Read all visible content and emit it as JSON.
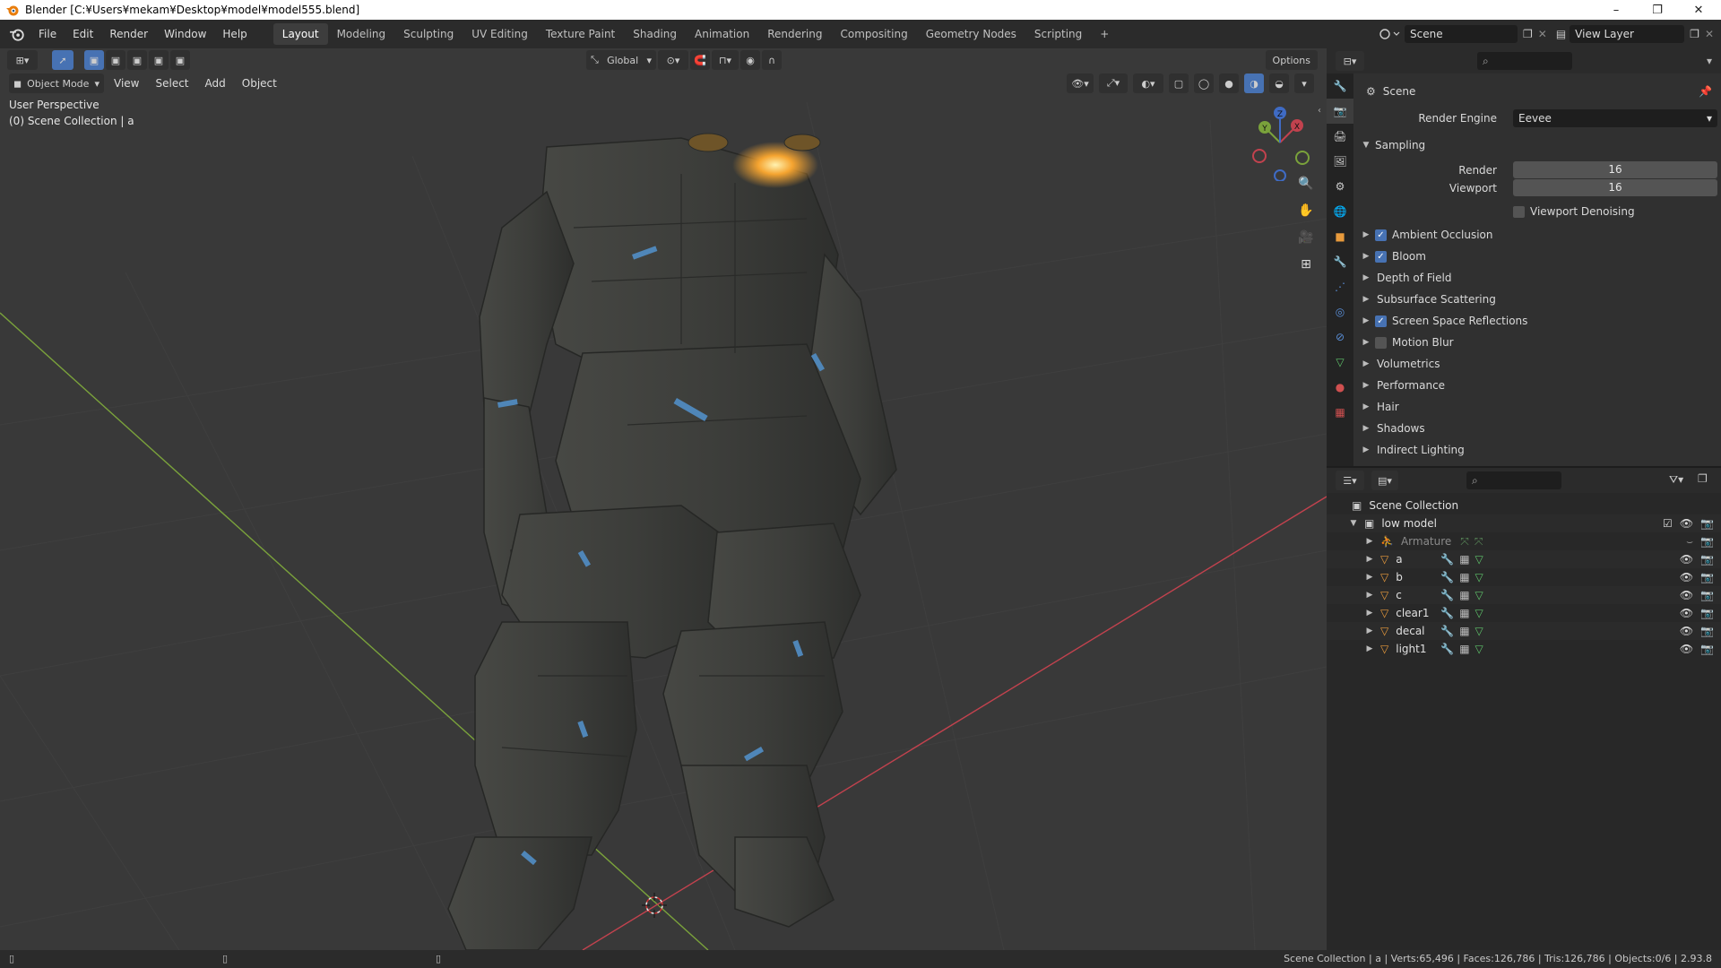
{
  "window": {
    "title": "Blender [C:¥Users¥mekam¥Desktop¥model¥model555.blend]",
    "controls": [
      "–",
      "❐",
      "✕"
    ]
  },
  "menu": [
    "File",
    "Edit",
    "Render",
    "Window",
    "Help"
  ],
  "workspaces": [
    "Layout",
    "Modeling",
    "Sculpting",
    "UV Editing",
    "Texture Paint",
    "Shading",
    "Animation",
    "Rendering",
    "Compositing",
    "Geometry Nodes",
    "Scripting"
  ],
  "active_workspace": "Layout",
  "add_workspace": "+",
  "scene_selector": {
    "value": "Scene"
  },
  "view_layer_selector": {
    "value": "View Layer"
  },
  "viewport": {
    "transform_orientation": "Global",
    "options_label": "Options",
    "mode": "Object Mode",
    "menus": [
      "View",
      "Select",
      "Add",
      "Object"
    ],
    "overlay_line1": "User Perspective",
    "overlay_line2": "(0) Scene Collection | a",
    "gizmo_axes": {
      "x": "X",
      "y": "Y",
      "z": "Z"
    }
  },
  "properties": {
    "context": "Scene",
    "render_engine_label": "Render Engine",
    "render_engine_value": "Eevee",
    "sampling": {
      "label": "Sampling",
      "render_label": "Render",
      "render_value": "16",
      "viewport_label": "Viewport",
      "viewport_value": "16",
      "denoise_label": "Viewport Denoising"
    },
    "panels": [
      {
        "label": "Ambient Occlusion",
        "checkbox": true,
        "checked": true
      },
      {
        "label": "Bloom",
        "checkbox": true,
        "checked": true
      },
      {
        "label": "Depth of Field",
        "checkbox": false
      },
      {
        "label": "Subsurface Scattering",
        "checkbox": false
      },
      {
        "label": "Screen Space Reflections",
        "checkbox": true,
        "checked": true
      },
      {
        "label": "Motion Blur",
        "checkbox": true,
        "checked": false
      },
      {
        "label": "Volumetrics",
        "checkbox": false
      },
      {
        "label": "Performance",
        "checkbox": false
      },
      {
        "label": "Hair",
        "checkbox": false
      },
      {
        "label": "Shadows",
        "checkbox": false
      },
      {
        "label": "Indirect Lighting",
        "checkbox": false
      }
    ]
  },
  "outliner": {
    "root": "Scene Collection",
    "collection": "low model",
    "items": [
      {
        "name": "Armature",
        "type": "armature"
      },
      {
        "name": "a",
        "type": "mesh"
      },
      {
        "name": "b",
        "type": "mesh"
      },
      {
        "name": "c",
        "type": "mesh"
      },
      {
        "name": "clear1",
        "type": "mesh"
      },
      {
        "name": "decal",
        "type": "mesh"
      },
      {
        "name": "light1",
        "type": "mesh"
      }
    ]
  },
  "status": {
    "text": "Scene Collection | a | Verts:65,496 | Faces:126,786 | Tris:126,786 | Objects:0/6 | 2.93.8"
  },
  "colors": {
    "accent": "#4772b3",
    "x_axis": "#c2424e",
    "y_axis": "#7aa23b",
    "z_axis": "#3f6bc4",
    "robot": "#3c3d3a"
  }
}
